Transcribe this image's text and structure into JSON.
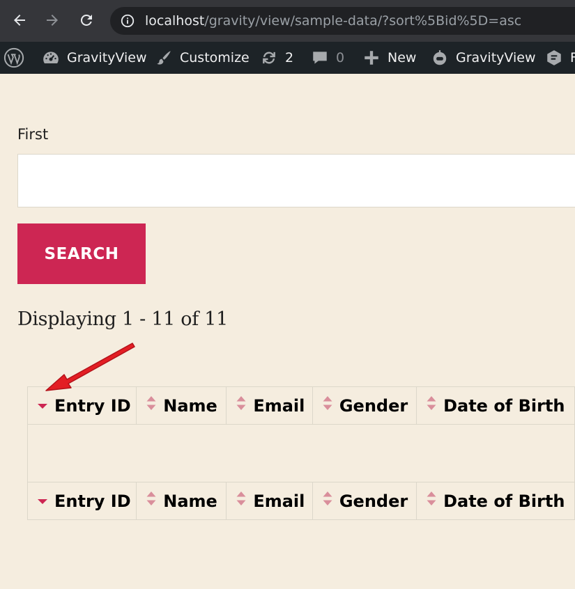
{
  "browser": {
    "url_host": "localhost",
    "url_path": "/gravity/view/sample-data/?sort%5Bid%5D=asc",
    "icons": [
      "back-arrow-icon",
      "forward-arrow-icon",
      "reload-icon",
      "info-icon"
    ]
  },
  "admin_bar": {
    "site_label": "GravityView",
    "customize_label": "Customize",
    "updates_count": "2",
    "comments_count": "0",
    "new_label": "New",
    "plugin_label": "GravityView",
    "cut_label": "F"
  },
  "search": {
    "field_label": "First",
    "input_value": "",
    "button_label": "SEARCH"
  },
  "results": {
    "summary": "Displaying 1 - 11 of 11"
  },
  "table": {
    "columns": [
      {
        "label": "Entry ID",
        "sort": "desc"
      },
      {
        "label": "Name",
        "sort": "both"
      },
      {
        "label": "Email",
        "sort": "both"
      },
      {
        "label": "Gender",
        "sort": "both"
      },
      {
        "label": "Date of Birth",
        "sort": "both"
      }
    ]
  },
  "colors": {
    "background": "#f5eddf",
    "accent": "#cd2653",
    "sort_icon": "#d98e9b",
    "annotation": "#e31e24"
  }
}
